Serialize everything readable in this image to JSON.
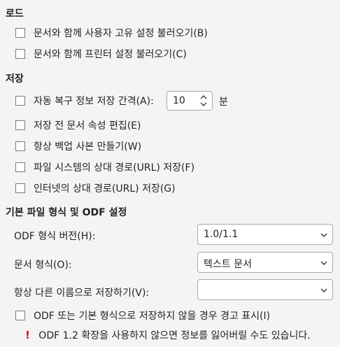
{
  "load": {
    "title": "로드",
    "options": [
      "문서와 함께 사용자 고유 설정 불러오기(B)",
      "문서와 함께 프린터 설정 불러오기(C)"
    ]
  },
  "save": {
    "title": "저장",
    "autorecovery_label": "자동 복구 정보 저장 간격(A):",
    "autorecovery_value": "10",
    "autorecovery_unit": "분",
    "options": [
      "저장 전 문서 속성 편집(E)",
      "항상 백업 사본 만들기(W)",
      "파일 시스템의 상대 경로(URL) 저장(F)",
      "인터넷의 상대 경로(URL) 저장(G)"
    ]
  },
  "default_format": {
    "title": "기본 파일 형식 및 ODF 설정",
    "odf_version_label": "ODF 형식 버전(H):",
    "odf_version_value": "1.0/1.1",
    "doc_type_label": "문서 형식(O):",
    "doc_type_value": "텍스트 문서",
    "always_save_as_label": "항상 다른 이름으로 저장하기(V):",
    "always_save_as_value": "",
    "warn_option": "ODF 또는 기본 형식으로 저장하지 않을 경우 경고 표시(I)",
    "warning_icon": "!",
    "warning_text": "ODF 1.2 확장을 사용하지 않으면 정보를 잃어버릴 수도 있습니다."
  }
}
